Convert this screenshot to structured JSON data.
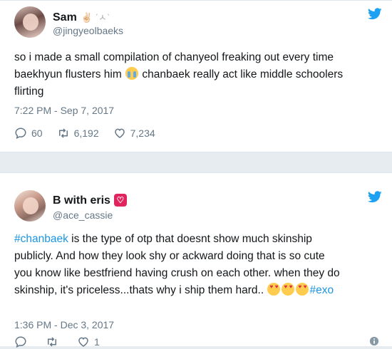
{
  "tweets": [
    {
      "display_name": "Sam",
      "name_decoration": "✌🏻 ˊㅅˋ",
      "handle": "@jingyeolbaeks",
      "text_lines": [
        "so i made a small compilation of chanyeol freaking out every time",
        "baekhyun flusters him",
        "chanbaek really act like middle schoolers",
        "flirting"
      ],
      "timestamp": "7:22 PM - Sep 7, 2017",
      "replies": "60",
      "retweets": "6,192",
      "likes": "7,234"
    },
    {
      "display_name": "B with eris",
      "handle": "@ace_cassie",
      "hashtag_start": "#chanbaek",
      "text_line1_rest": " is the type of otp that doesnt show much skinship",
      "text_line2": "publicly. And how they look shy or ackward doing that is so cute",
      "text_line3": "you know like bestfriend having crush on each other. when they do",
      "text_line4": "skinship, it's priceless...thats why i ship them hard..",
      "hashtag_end": "#exo",
      "timestamp": "1:36 PM - Dec 3, 2017",
      "replies": "",
      "retweets": "",
      "likes": "1"
    }
  ],
  "colors": {
    "brand": "#1da1f2",
    "link": "#1b95e0",
    "secondary_text": "#657786",
    "like_heart": "#e0245e"
  },
  "icons": [
    "twitter-bird-icon",
    "reply-icon",
    "retweet-icon",
    "like-icon",
    "info-icon",
    "crying-emoji-icon",
    "heart-eyes-emoji-icon"
  ]
}
